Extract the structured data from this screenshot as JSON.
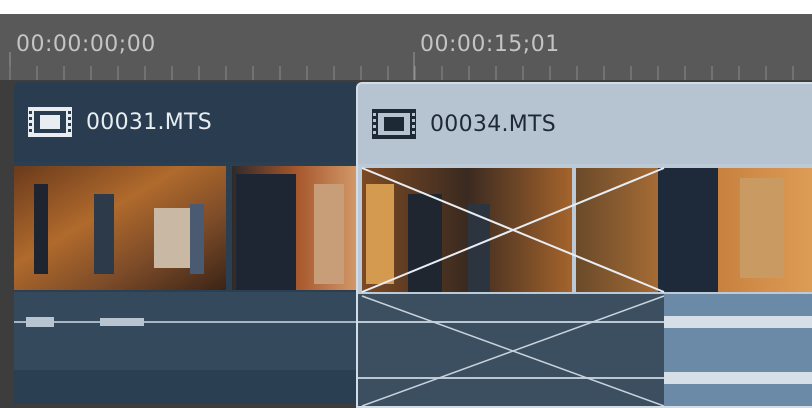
{
  "ruler": {
    "timecode_start": "00:00:00;00",
    "timecode_mid": "00:00:15;01"
  },
  "clips": [
    {
      "name": "00031.MTS",
      "icon": "film-strip-icon",
      "state": "unselected"
    },
    {
      "name": "00034.MTS",
      "icon": "film-strip-icon",
      "state": "selected"
    }
  ],
  "colors": {
    "ruler_bg": "#595959",
    "clip_bg": "#2b3f52",
    "clip_selected_bg": "#bccad8",
    "audio_bg": "#34495c",
    "audio_selected_bg": "#6a8aa8"
  }
}
